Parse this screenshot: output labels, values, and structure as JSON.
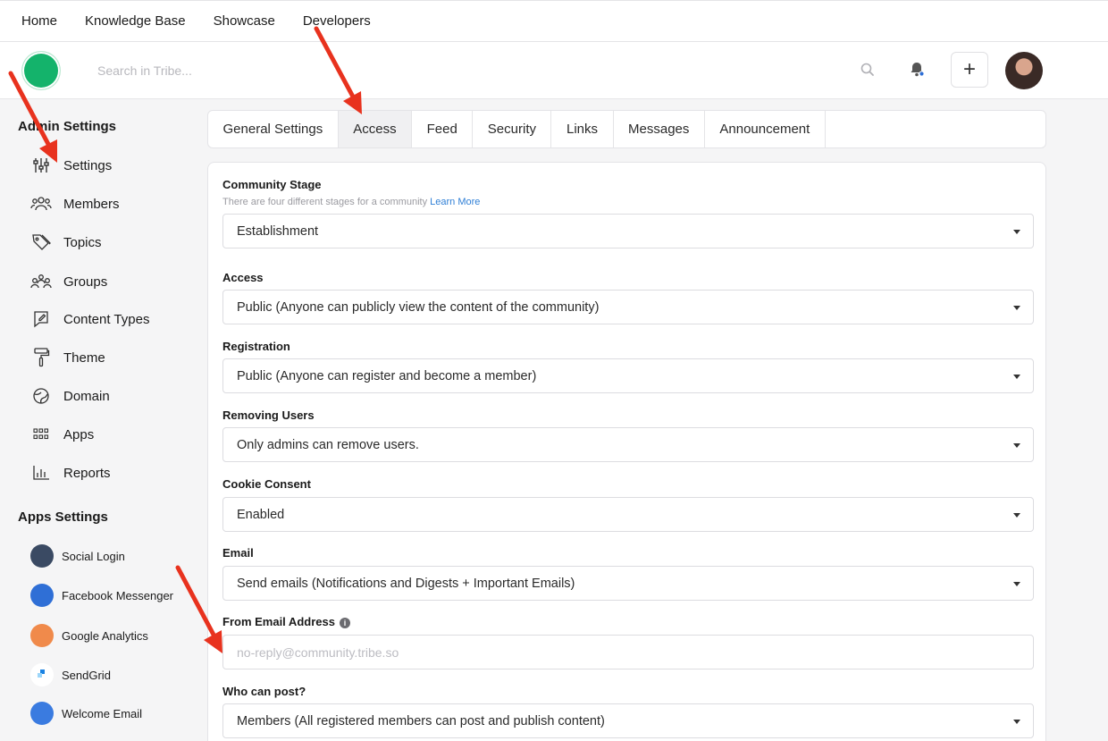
{
  "topnav": {
    "items": [
      "Home",
      "Knowledge Base",
      "Showcase",
      "Developers"
    ]
  },
  "header": {
    "search_placeholder": "Search in Tribe...",
    "add_label": "+"
  },
  "sidebar": {
    "admin_title": "Admin Settings",
    "admin_items": [
      {
        "label": "Settings",
        "icon": "sliders-icon"
      },
      {
        "label": "Members",
        "icon": "members-icon"
      },
      {
        "label": "Topics",
        "icon": "tag-icon"
      },
      {
        "label": "Groups",
        "icon": "groups-icon"
      },
      {
        "label": "Content Types",
        "icon": "content-types-icon"
      },
      {
        "label": "Theme",
        "icon": "paint-roller-icon"
      },
      {
        "label": "Domain",
        "icon": "globe-icon"
      },
      {
        "label": "Apps",
        "icon": "apps-grid-icon"
      },
      {
        "label": "Reports",
        "icon": "bar-chart-icon"
      }
    ],
    "apps_title": "Apps Settings",
    "app_items": [
      {
        "label": "Social Login",
        "color": "#3a4a63"
      },
      {
        "label": "Facebook Messenger",
        "color": "#2f6fd6"
      },
      {
        "label": "Google Analytics",
        "color": "#f08a4b"
      },
      {
        "label": "SendGrid",
        "color": "#1a82e2"
      },
      {
        "label": "Welcome Email",
        "color": "#3a7be0"
      }
    ]
  },
  "tabs": [
    "General Settings",
    "Access",
    "Feed",
    "Security",
    "Links",
    "Messages",
    "Announcement"
  ],
  "active_tab": "Access",
  "form": {
    "community_stage": {
      "label": "Community Stage",
      "hint": "There are four different stages for a community",
      "hint_link": "Learn More",
      "value": "Establishment"
    },
    "access": {
      "label": "Access",
      "value": "Public (Anyone can publicly view the content of the community)"
    },
    "registration": {
      "label": "Registration",
      "value": "Public (Anyone can register and become a member)"
    },
    "removing_users": {
      "label": "Removing Users",
      "value": "Only admins can remove users."
    },
    "cookie_consent": {
      "label": "Cookie Consent",
      "value": "Enabled"
    },
    "email": {
      "label": "Email",
      "value": "Send emails (Notifications and Digests + Important Emails)"
    },
    "from_email": {
      "label": "From Email Address",
      "info_glyph": "i",
      "placeholder": "no-reply@community.tribe.so"
    },
    "who_can_post": {
      "label": "Who can post?",
      "value": "Members (All registered members can post and publish content)"
    }
  },
  "colors": {
    "accent": "#14b36b",
    "annotation_arrow": "#e8321e",
    "link": "#2f7fd6"
  }
}
